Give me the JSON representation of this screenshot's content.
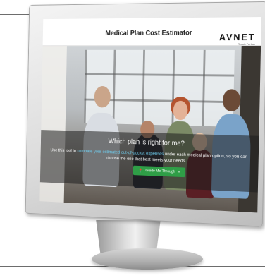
{
  "app": {
    "title": "Medical Plan Cost Estimator",
    "brand": "AVNET",
    "brand_tagline": "Reach Further"
  },
  "hero": {
    "headline": "Which plan is right for me?",
    "description_before": "Use this tool to ",
    "description_link": "compare your estimated out-of-pocket expenses",
    "description_after": " under each medical plan option, so you can choose the one that best meets your needs.",
    "cta_label": "Guide Me Through",
    "cta_icon": "map-pin-icon",
    "cta_arrow": "double-chevron-right-icon"
  },
  "colors": {
    "cta_green": "#2f9e47",
    "link_blue": "#6fd0f2",
    "overlay": "rgba(30,30,30,0.55)"
  }
}
